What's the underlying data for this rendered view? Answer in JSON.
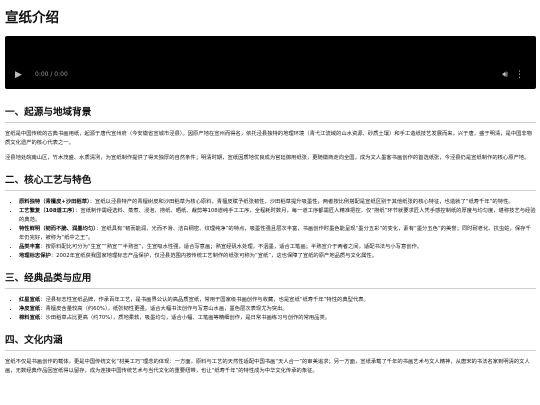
{
  "page": {
    "title": "宣纸介绍"
  },
  "video": {
    "time_label": "0:00 / 0:00",
    "play_icon": "play-icon",
    "volume_icon": "volume-icon",
    "more_icon": "more-options-icon"
  },
  "sections": [
    {
      "heading": "一、起源与地域背景",
      "paragraphs": [
        "宣纸是中国传统的古典书画用纸，起源于唐代宣州府（今安徽省宣城市泾县）。因原产地在宣州而得名，依托泾县独特的地理环境（青弋江流域的山水资源、砂质土壤）和手工造纸技艺发展而来，兴于唐，盛于明清，是中国非物质文化遗产的核心代表之一。",
        "泾县地处皖南山区，竹木茂盛、水质清冽，为宣纸制作提供了得天独厚的自然条件；明清时期，宣纸因质地优良成为官廷御用纸张，更随徽商走向全国，成为文人墨客书画创作的首选纸张，今泾县仍是宣纸制作的核心原产地。"
      ]
    },
    {
      "heading": "二、核心工艺与特色",
      "items": [
        {
          "term": "原料独特（青檀皮+沙田稻草）",
          "text": "：宣纸以泾县特产的青檀树皮和沙田稻草为核心原料，青檀皮赋予纸张韧性，沙田稻草提升吸墨性，两者按比例搭配是宣纸区别于其他纸张的核心特征，也造就了“纸寿千年”的特性。"
        },
        {
          "term": "工艺繁复（108道工序）",
          "text": "：宣纸制作需经选料、蒸煮、浸泡、捞纸、晒纸、裁剪等108道纯手工工序，全程耗时数月，每一道工序都需匠人精准把控，仅“捞纸”环节就要求匠人凭手感控制纸的厚度与均匀度，堪称技艺与经验的典范。"
        },
        {
          "term": "特性鲜明（韧而不脆、润墨均匀）",
          "text": "：宣纸具有“韧而能润、光而不滑、洁白稠密、纹理纯净”的特点，吸墨性强且层次丰富，书画创作时墨色能呈现“墨分五彩”的变化，素有“墨分五色”的美誉；同时耐老化、抗虫蛀，保存千年仍完好，被称为“纸中之王”。"
        },
        {
          "term": "品类丰富",
          "text": "：按原料配比可分为“生宣”“熟宣”“半熟宣”，生宣吸水性强，适合写意画；熟宣经矾水处理，不洇墨，适合工笔画；半熟宣介于两者之间，适配书法与小写意创作。"
        },
        {
          "term": "地理标志保护",
          "text": "：2002年宣纸获我国家地理标志产品保护，仅泾县范围内按传统工艺制作的纸张可称为“宣纸”，这也保障了宣纸的原产地品质与文化属性。"
        }
      ]
    },
    {
      "heading": "三、经典品类与应用",
      "items": [
        {
          "term": "红星宣纸",
          "text": "：泾县标志性宣纸品牌，作承百年工艺，是书画界公认的高品质宣纸，常用于国家级书画创作与收藏，也是宣纸“纸寿千年”特性的典型代表。"
        },
        {
          "term": "净皮宣纸",
          "text": "：青檀皮含量较高（约60%），纸张韧性更强，适合大幅书法创作与写意山水画，墨色层次表现尤为突出。"
        },
        {
          "term": "棉料宣纸",
          "text": "：沙田稻草占比更高（约70%），质地柔软，吸墨均匀，适合小幅、工笔画等精细创作，是日常书画练习与创作的常用品类。"
        }
      ]
    },
    {
      "heading": "四、文化内涵",
      "paragraphs": [
        "宣纸不仅是书画创作的载体，更是中国传统文化“材美工巧”理念的体现：一方面，原料与工艺的天然性适配中国书画“天人合一”的审美追求；另一方面，宣纸承载了千年的书画艺术与文人精神，从唐宋的书法名家到明清的文人画，无数经典作品因宣纸得以留存，成为连接中国传统艺术与当代文化的重要纽带，也让“纸寿千年”的特性成为中华文化传承的象征。"
      ]
    }
  ]
}
